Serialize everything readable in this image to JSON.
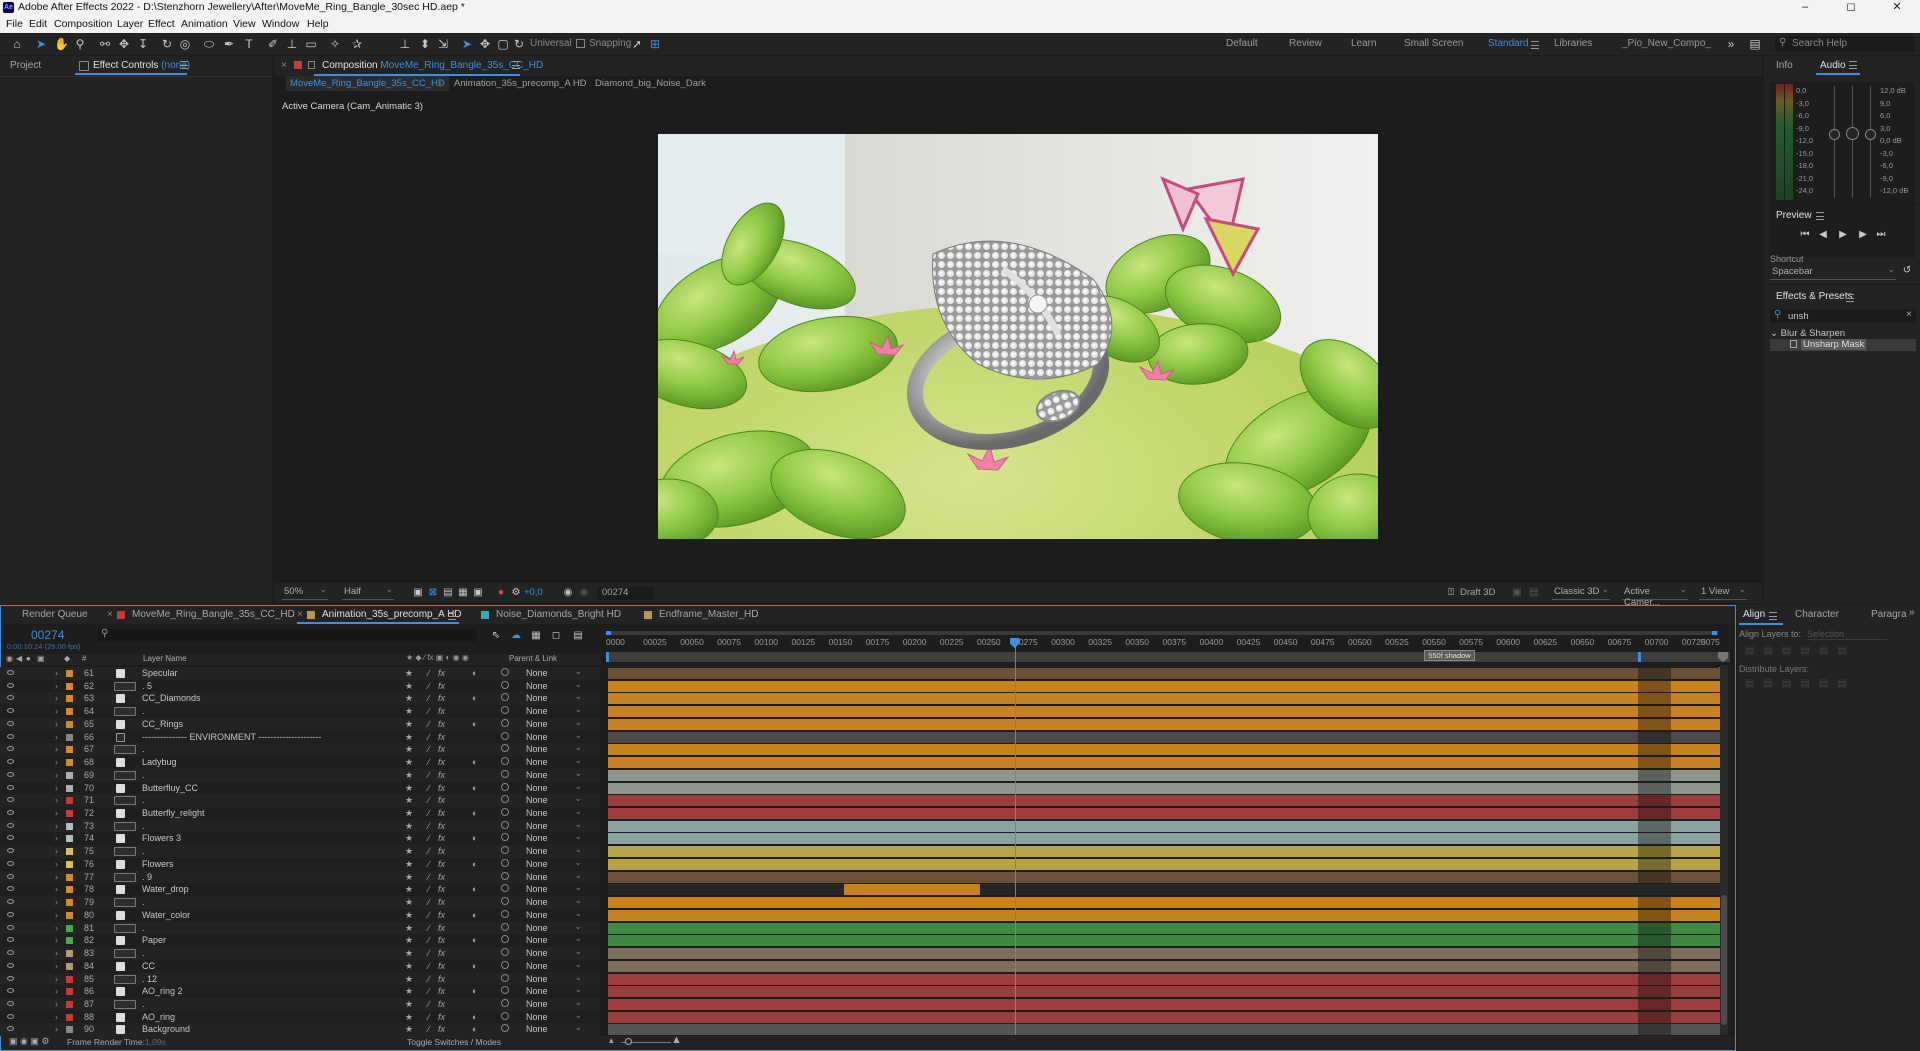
{
  "window": {
    "title": "Adobe After Effects 2022 - D:\\Stenzhorn Jewellery\\After\\MoveMe_Ring_Bangle_30sec HD.aep *",
    "app_icon": "Ae",
    "controls": [
      "minimize-icon",
      "maximize-icon",
      "close-icon"
    ]
  },
  "menu": [
    "File",
    "Edit",
    "Composition",
    "Layer",
    "Effect",
    "Animation",
    "View",
    "Window",
    "Help"
  ],
  "toolbar": {
    "axis_mode": "Universal",
    "snapping": "Snapping",
    "workspaces": [
      "Default",
      "Review",
      "Learn",
      "Small Screen",
      "Standard",
      "Libraries",
      "_Pio_New_Compo_"
    ],
    "active_workspace": "Standard",
    "search_help": "Search Help"
  },
  "left_panel": {
    "tabs": [
      "Project",
      "Effect Controls"
    ],
    "effect_controls_suffix": "(none)"
  },
  "composition_panel": {
    "tab_prefix": "Composition",
    "tab_name": "MoveMe_Ring_Bangle_35s_CC_HD",
    "breadcrumbs": [
      "MoveMe_Ring_Bangle_35s_CC_HD",
      "Animation_35s_precomp_A HD",
      "Diamond_big_Noise_Dark"
    ],
    "camera_label": "Active Camera (Cam_Animatic 3)",
    "footer": {
      "zoom": "50%",
      "resolution": "Half",
      "exposure": "+0,0",
      "timecode": "00274",
      "draft3d": "Draft 3D",
      "renderer": "Classic 3D",
      "view": "Active Camer...",
      "views": "1 View"
    }
  },
  "right_panel": {
    "tabs": [
      "Info",
      "Audio"
    ],
    "audio_left_scale": [
      "0,0",
      "-3,0",
      "-6,0",
      "-9,0",
      "-12,0",
      "-15,0",
      "-18,0",
      "-21,0",
      "-24,0"
    ],
    "audio_right_scale": [
      "12,0 dB",
      "9,0",
      "6,0",
      "3,0",
      "0,0 dB",
      "-3,0",
      "-6,0",
      "-9,0",
      "-12,0 dB"
    ],
    "preview_title": "Preview",
    "shortcut_label": "Shortcut",
    "shortcut_value": "Spacebar",
    "effects_title": "Effects & Presets",
    "effects_search": "unsh",
    "effects_category": "Blur & Sharpen",
    "effects_result": "Unsharp Mask"
  },
  "timeline": {
    "tabs": [
      {
        "label": "Render Queue",
        "color": ""
      },
      {
        "label": "MoveMe_Ring_Bangle_35s_CC_HD",
        "color": "#c83a3a"
      },
      {
        "label": "Animation_35s_precomp_A HD",
        "color": "#b39a5a"
      },
      {
        "label": "Noise_Diamonds_Bright HD",
        "color": "#3aa8b0"
      },
      {
        "label": "Endframe_Master_HD",
        "color": "#b39a5a"
      }
    ],
    "active_tab": 2,
    "timecode": "00274",
    "timecode_sub": "0:00:10:24 (25.00 fps)",
    "column_hash": "#",
    "column_layer_name": "Layer Name",
    "column_parent": "Parent & Link",
    "ruler": [
      "0000",
      "00025",
      "00050",
      "00075",
      "00100",
      "00125",
      "00150",
      "00175",
      "00200",
      "00225",
      "00250",
      "00275",
      "00300",
      "00325",
      "00350",
      "00375",
      "00400",
      "00425",
      "00450",
      "00475",
      "00500",
      "00525",
      "00550",
      "00575",
      "00600",
      "00625",
      "00650",
      "00675",
      "00700",
      "00725",
      "0075"
    ],
    "marker_label": "550f shadow",
    "playhead_frame": 274,
    "duration_frames": 750,
    "footer_left": "Frame Render Time:",
    "footer_left_value": "1,09s",
    "footer_center": "Toggle Switches / Modes",
    "parent_none": "None",
    "layers": [
      {
        "num": "61",
        "name": "Specular",
        "color": "#d4892a",
        "bar": "#6b5236",
        "start": 0,
        "end": 1
      },
      {
        "num": "62",
        "name": ". 5",
        "color": "#d4892a",
        "bar": "#c8821e",
        "start": 0,
        "end": 1
      },
      {
        "num": "63",
        "name": "CC_Diamonds",
        "color": "#d4892a",
        "bar": "#c8821e",
        "start": 0,
        "end": 1
      },
      {
        "num": "64",
        "name": ".",
        "color": "#d4892a",
        "bar": "#c8821e",
        "start": 0,
        "end": 1
      },
      {
        "num": "65",
        "name": "CC_Rings",
        "color": "#d4892a",
        "bar": "#c8821e",
        "start": 0,
        "end": 1
      },
      {
        "num": "66",
        "name": "---------------  ENVIRONMENT  ---------------------",
        "color": "#888888",
        "bar": "#4a4a4a",
        "start": 0,
        "end": 1
      },
      {
        "num": "67",
        "name": ".",
        "color": "#d4892a",
        "bar": "#c8821e",
        "start": 0,
        "end": 1
      },
      {
        "num": "68",
        "name": "Ladybug",
        "color": "#d4892a",
        "bar": "#c8821e",
        "start": 0,
        "end": 1
      },
      {
        "num": "69",
        "name": ".",
        "color": "#a8b0a8",
        "bar": "#8e968c",
        "start": 0,
        "end": 1
      },
      {
        "num": "70",
        "name": "Butterfluy_CC",
        "color": "#a8b0a8",
        "bar": "#8e968c",
        "start": 0,
        "end": 1
      },
      {
        "num": "71",
        "name": ".",
        "color": "#c83a3a",
        "bar": "#9e3d3d",
        "start": 0,
        "end": 1
      },
      {
        "num": "72",
        "name": "Butterfly_relight",
        "color": "#c83a3a",
        "bar": "#9e3d3d",
        "start": 0,
        "end": 1
      },
      {
        "num": "73",
        "name": ".",
        "color": "#a8c4c0",
        "bar": "#8aa3a0",
        "start": 0,
        "end": 1
      },
      {
        "num": "74",
        "name": "Flowers 3",
        "color": "#a8c4c0",
        "bar": "#8aa3a0",
        "start": 0,
        "end": 1
      },
      {
        "num": "75",
        "name": ".",
        "color": "#d8c254",
        "bar": "#b8a442",
        "start": 0,
        "end": 1
      },
      {
        "num": "76",
        "name": "Flowers",
        "color": "#d8c254",
        "bar": "#b8a442",
        "start": 0,
        "end": 1
      },
      {
        "num": "77",
        "name": ". 9",
        "color": "#d4892a",
        "bar": "#6b5236",
        "start": 0,
        "end": 1
      },
      {
        "num": "78",
        "name": "Water_drop",
        "color": "#d4892a",
        "bar": "#c8821e",
        "start": 0.212,
        "end": 0.334
      },
      {
        "num": "79",
        "name": ".",
        "color": "#d4892a",
        "bar": "#c8821e",
        "start": 0,
        "end": 1
      },
      {
        "num": "80",
        "name": "Water_color",
        "color": "#d4892a",
        "bar": "#c8821e",
        "start": 0,
        "end": 1
      },
      {
        "num": "81",
        "name": ".",
        "color": "#4aa84a",
        "bar": "#3f8a43",
        "start": 0,
        "end": 1
      },
      {
        "num": "82",
        "name": "Paper",
        "color": "#4aa84a",
        "bar": "#3f8a43",
        "start": 0,
        "end": 1
      },
      {
        "num": "83",
        "name": ".",
        "color": "#b39a7a",
        "bar": "#7d6d5a",
        "start": 0,
        "end": 1
      },
      {
        "num": "84",
        "name": "CC",
        "color": "#b39a7a",
        "bar": "#7d6d5a",
        "start": 0,
        "end": 1
      },
      {
        "num": "85",
        "name": ". 12",
        "color": "#c83a3a",
        "bar": "#9e3d3d",
        "start": 0,
        "end": 1
      },
      {
        "num": "86",
        "name": "AO_ring 2",
        "color": "#c83a3a",
        "bar": "#9e3d3d",
        "start": 0,
        "end": 1
      },
      {
        "num": "87",
        "name": ".",
        "color": "#c83a3a",
        "bar": "#9e3d3d",
        "start": 0,
        "end": 1
      },
      {
        "num": "88",
        "name": "AO_ring",
        "color": "#c83a3a",
        "bar": "#9e3d3d",
        "start": 0,
        "end": 1
      },
      {
        "num": "90",
        "name": "Background",
        "color": "#888888",
        "bar": "#555555",
        "start": 0,
        "end": 1
      }
    ]
  },
  "align_panel": {
    "tabs": [
      "Align",
      "Character",
      "Paragra"
    ],
    "align_layers_to": "Align Layers to:",
    "align_target": "Selection",
    "distribute": "Distribute Layers:"
  }
}
